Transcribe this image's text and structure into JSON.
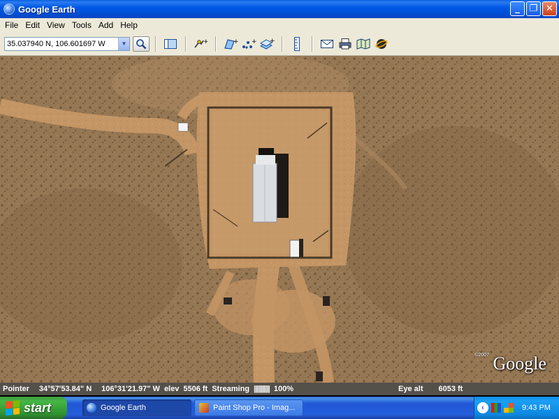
{
  "window": {
    "title": "Google Earth",
    "controls": {
      "minimize": "_",
      "maximize": "❐",
      "close": "✕"
    }
  },
  "menu": {
    "items": [
      "File",
      "Edit",
      "View",
      "Tools",
      "Add",
      "Help"
    ]
  },
  "toolbar": {
    "search_value": "35.037940 N, 106.601697 W",
    "tools": [
      "sidebar-icon",
      "hide-sidebar",
      "placemark-icon",
      "polygon-icon",
      "path-icon",
      "image-overlay-icon",
      "ruler-icon",
      "email-icon",
      "print-icon",
      "maps-icon",
      "sky-icon"
    ]
  },
  "map": {
    "watermark": "Google",
    "copyright": "©2007"
  },
  "status": {
    "pointer_label": "Pointer",
    "lat": "34°57'53.84\" N",
    "lon": "106°31'21.97\" W",
    "elev_label": "elev",
    "elev_value": "5506 ft",
    "streaming_label": "Streaming",
    "streaming_bar": "|||||||||||",
    "streaming_pct": "100%",
    "eye_alt_label": "Eye alt",
    "eye_alt_value": "6053 ft"
  },
  "taskbar": {
    "start_label": "start",
    "tasks": [
      {
        "label": "Google Earth",
        "active": true
      },
      {
        "label": "Paint Shop Pro - Imag...",
        "active": false
      }
    ],
    "clock": "9:43 PM"
  }
}
